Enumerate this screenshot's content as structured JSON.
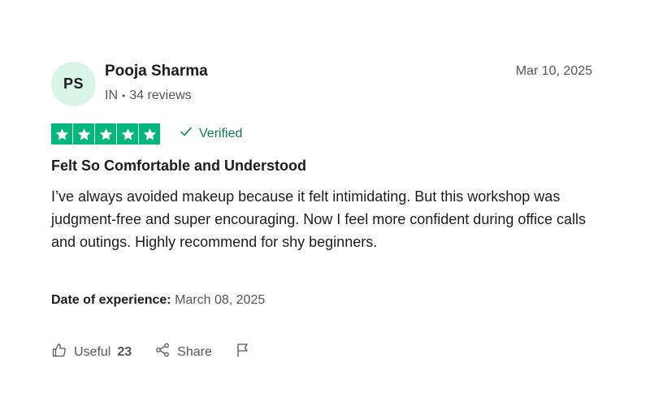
{
  "reviewer": {
    "initials": "PS",
    "name": "Pooja Sharma",
    "country": "IN",
    "reviews_count": "34 reviews"
  },
  "review": {
    "date": "Mar 10, 2025",
    "rating": 5,
    "verified_label": "Verified",
    "title": "Felt So Comfortable and Understood",
    "body": "I’ve always avoided makeup because it felt intimidating. But this workshop was judgment-free and super encouraging. Now I feel more confident during office calls and outings. Highly recommend for shy beginners.",
    "experience_label": "Date of experience:",
    "experience_date": "March 08, 2025"
  },
  "actions": {
    "useful_label": "Useful",
    "useful_count": "23",
    "share_label": "Share"
  },
  "icons": {
    "star": "star-icon",
    "verified": "checkmark-icon",
    "useful": "thumbs-up-icon",
    "share": "share-icon",
    "report": "flag-icon"
  },
  "colors": {
    "star_green": "#00b67a",
    "verified_green": "#0f7a50",
    "avatar_bg": "#d9f5ea"
  }
}
